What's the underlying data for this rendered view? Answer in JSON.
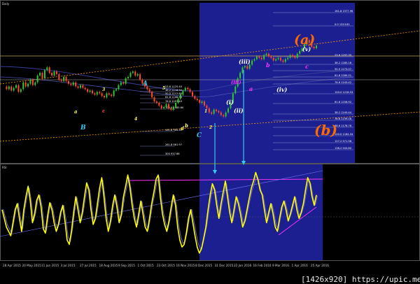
{
  "window": {
    "main_caption": "Daily",
    "sub_caption": "RSI"
  },
  "watermark": "[1426x920] https://upic.me/",
  "colors": {
    "background": "#000000",
    "highlight": "#1b1f8f",
    "price_up": "#ff4a2a",
    "price_down": "#32c832",
    "rsi": "#ffff00",
    "rsi_shadow": "#6b63c7",
    "cyan": "#33ccee",
    "magenta": "#ff33ff",
    "orange": "#ff6a00",
    "trend": "#ff9a00"
  },
  "chart_data": [
    {
      "type": "line",
      "panel": "price",
      "caption": "Daily",
      "x_labels": [
        "28 Apr 2015",
        "20 May 2015",
        "11 Jun 2015",
        "3 Jul 2015",
        "27 Jul 2015",
        "18 Aug 2015",
        "9 Sep 2015",
        "1 Oct 2015",
        "23 Oct 2015",
        "16 Nov 2015",
        "8 Dec 2015",
        "31 Dec 2015",
        "22 Jan 2016",
        "16 Feb 2016",
        "9 Mar 2016",
        "1 Apr 2016",
        "25 Apr 2016"
      ],
      "price_path": [
        0.52,
        0.5,
        0.52,
        0.49,
        0.51,
        0.53,
        0.48,
        0.5,
        0.55,
        0.52,
        0.54,
        0.57,
        0.53,
        0.55,
        0.6,
        0.62,
        0.58,
        0.64,
        0.66,
        0.62,
        0.6,
        0.63,
        0.61,
        0.57,
        0.56,
        0.59,
        0.56,
        0.54,
        0.53,
        0.55,
        0.52,
        0.51,
        0.53,
        0.51,
        0.5,
        0.48,
        0.49,
        0.47,
        0.46,
        0.48,
        0.47,
        0.45,
        0.44,
        0.47,
        0.46,
        0.45,
        0.49,
        0.5,
        0.53,
        0.55,
        0.54,
        0.58,
        0.59,
        0.62,
        0.63,
        0.6,
        0.61,
        0.57,
        0.54,
        0.52,
        0.5,
        0.48,
        0.44,
        0.41,
        0.4,
        0.38,
        0.36,
        0.37,
        0.39,
        0.36,
        0.35,
        0.37,
        0.4,
        0.43,
        0.46,
        0.49,
        0.51,
        0.5,
        0.48,
        0.45,
        0.43,
        0.42,
        0.4,
        0.41,
        0.38,
        0.36,
        0.33,
        0.32,
        0.35,
        0.34,
        0.33,
        0.31,
        0.3,
        0.33,
        0.36,
        0.4,
        0.47,
        0.52,
        0.58,
        0.62,
        0.66,
        0.67,
        0.65,
        0.68,
        0.71,
        0.72,
        0.74,
        0.73,
        0.72,
        0.75,
        0.76,
        0.74,
        0.73,
        0.71,
        0.72,
        0.73,
        0.71,
        0.7,
        0.72,
        0.73,
        0.75,
        0.74,
        0.73,
        0.76,
        0.78,
        0.8,
        0.83,
        0.86,
        0.84,
        0.81,
        0.8,
        0.82
      ],
      "fib_levels": [
        "161.8 1577.96",
        "0.0 1313.81",
        "23.6 1297.35",
        "38.2 1285.18",
        "50.0 1273.07",
        "61.8 1260.51",
        "78.6 1243.42",
        "100.0 1218.53",
        "61.8 1256.92",
        "38.2 1245.44",
        "78.6 1199.08",
        "88.6 1176.78",
        "100.0 1164.54",
        "127.2 971.98",
        "138.2 943.80"
      ],
      "left_fib_levels": [
        "23.6 1125.40",
        "38.2 1118.90",
        "50.0 1112.80",
        "61.8 1106.90",
        "78.6 1097.40",
        "100.0 1085.60",
        "161.8 984.42",
        "261.8 961.97",
        "300 937.68"
      ],
      "wave_labels": [
        "(a)",
        "(b)",
        "(iii)",
        "(ii)",
        "(iv)",
        "(v)",
        "(i)",
        "(iii)",
        "a",
        "b",
        "c",
        "A",
        "B",
        "C",
        "i",
        "ii",
        "iii",
        "iv",
        "v",
        "1",
        "2",
        "3",
        "4",
        "5",
        "a",
        "b",
        "c",
        "d"
      ]
    },
    {
      "type": "line",
      "panel": "oscillator",
      "caption": "RSI",
      "series": [
        {
          "values": [
            0.55,
            0.45,
            0.35,
            0.3,
            0.25,
            0.4,
            0.55,
            0.62,
            0.45,
            0.3,
            0.55,
            0.7,
            0.82,
            0.65,
            0.4,
            0.5,
            0.66,
            0.72,
            0.58,
            0.33,
            0.28,
            0.48,
            0.63,
            0.55,
            0.4,
            0.3,
            0.38,
            0.52,
            0.6,
            0.42,
            0.2,
            0.15,
            0.3,
            0.52,
            0.7,
            0.55,
            0.4,
            0.52,
            0.7,
            0.86,
            0.78,
            0.55,
            0.38,
            0.45,
            0.62,
            0.8,
            0.92,
            0.7,
            0.45,
            0.3,
            0.42,
            0.6,
            0.72,
            0.58,
            0.4,
            0.5,
            0.7,
            0.82,
            0.95,
            0.8,
            0.6,
            0.45,
            0.35,
            0.5,
            0.65,
            0.5,
            0.35,
            0.3,
            0.45,
            0.62,
            0.75,
            0.9,
            0.95,
            0.7,
            0.5,
            0.38,
            0.3,
            0.42,
            0.58,
            0.72,
            0.6,
            0.35,
            0.2,
            0.12,
            0.15,
            0.28,
            0.45,
            0.55,
            0.4,
            0.25,
            0.12,
            0.05,
            0.1,
            0.22,
            0.35,
            0.55,
            0.72,
            0.85,
            0.78,
            0.6,
            0.45,
            0.62,
            0.75,
            0.88,
            0.7,
            0.52,
            0.4,
            0.55,
            0.7,
            0.62,
            0.5,
            0.35,
            0.42,
            0.55,
            0.68,
            0.8,
            0.88,
            0.98,
            0.9,
            0.78,
            0.72,
            0.55,
            0.4,
            0.52,
            0.62,
            0.5,
            0.35,
            0.3,
            0.45,
            0.58,
            0.65,
            0.55,
            0.42,
            0.5,
            0.6,
            0.7,
            0.55,
            0.45,
            0.52,
            0.62,
            0.78,
            0.92,
            0.86,
            0.7,
            0.6,
            0.72
          ]
        }
      ]
    }
  ]
}
